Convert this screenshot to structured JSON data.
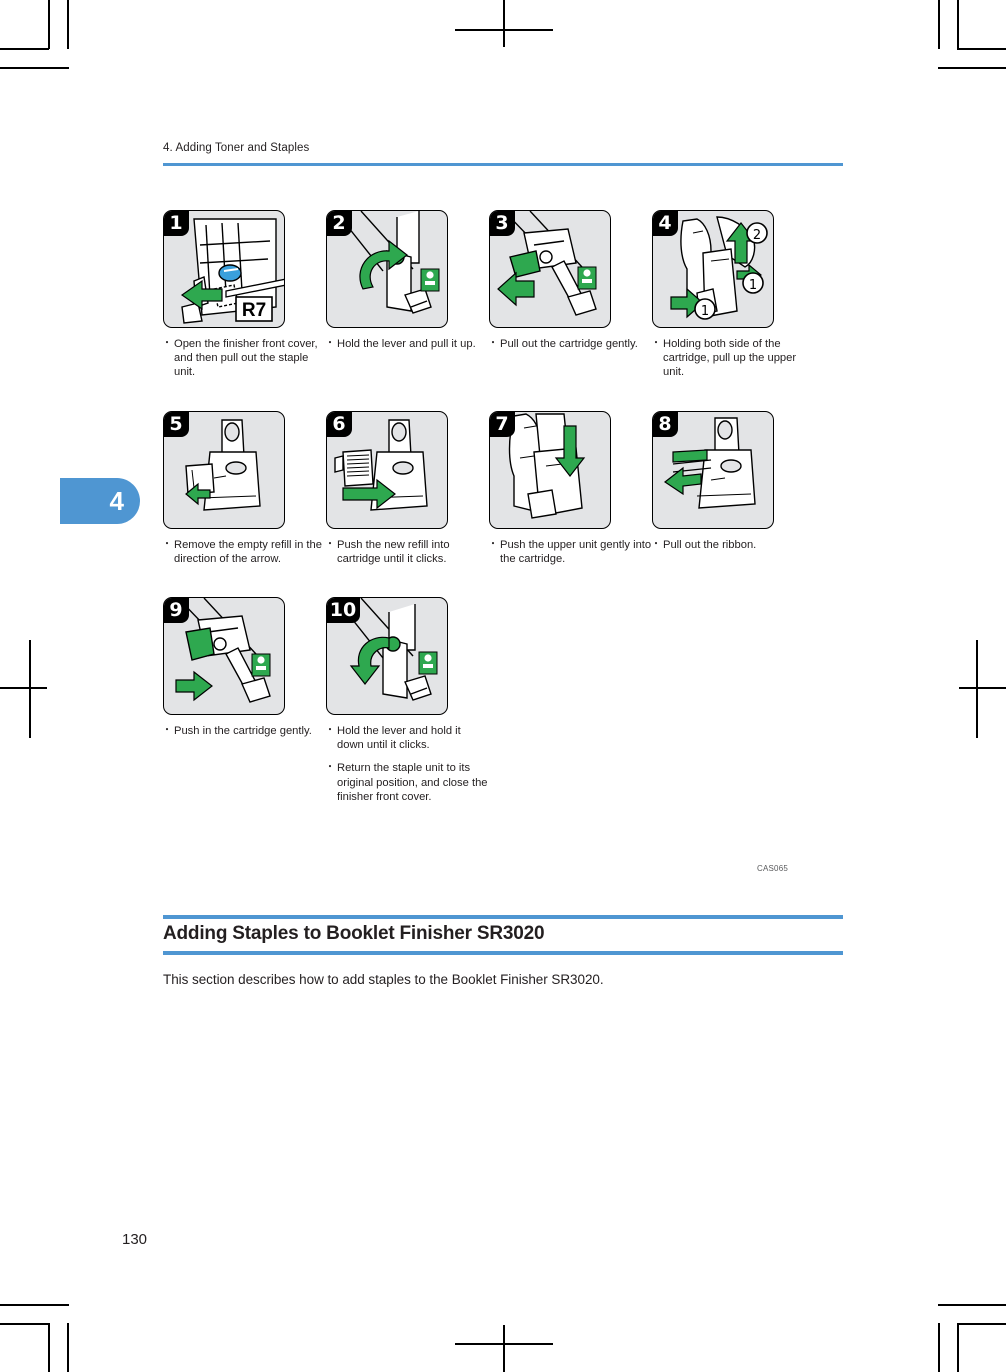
{
  "page": {
    "running_header": "4. Adding Toner and Staples",
    "chapter_tab": "4",
    "folio": "130",
    "figure_code": "CAS065"
  },
  "steps": [
    {
      "number": "1",
      "label_in_art": "R7",
      "captions": [
        "Open the finisher front cover, and then pull out the staple unit."
      ]
    },
    {
      "number": "2",
      "captions": [
        "Hold the lever and pull it up."
      ]
    },
    {
      "number": "3",
      "captions": [
        "Pull out the cartridge gently."
      ]
    },
    {
      "number": "4",
      "callouts": [
        "1",
        "1",
        "2"
      ],
      "captions": [
        "Holding both side of the cartridge, pull up the upper unit."
      ]
    },
    {
      "number": "5",
      "captions": [
        "Remove the empty refill in the direction of the arrow."
      ]
    },
    {
      "number": "6",
      "captions": [
        "Push the new refill into cartridge until it clicks."
      ]
    },
    {
      "number": "7",
      "captions": [
        "Push the upper unit gently into the cartridge."
      ]
    },
    {
      "number": "8",
      "captions": [
        "Pull out the ribbon."
      ]
    },
    {
      "number": "9",
      "captions": [
        "Push in the cartridge gently."
      ]
    },
    {
      "number": "10",
      "captions": [
        "Hold the lever and hold it down until it clicks.",
        "Return the staple unit to its original position, and close the finisher front cover."
      ]
    }
  ],
  "section": {
    "title": "Adding Staples to Booklet Finisher SR3020",
    "body": "This section describes how to add staples to the Booklet Finisher SR3020."
  },
  "colors": {
    "rule_blue": "#4f96d2",
    "arrow_green": "#2ea84f",
    "panel_gray": "#e3e4e6",
    "text": "#231f20"
  }
}
